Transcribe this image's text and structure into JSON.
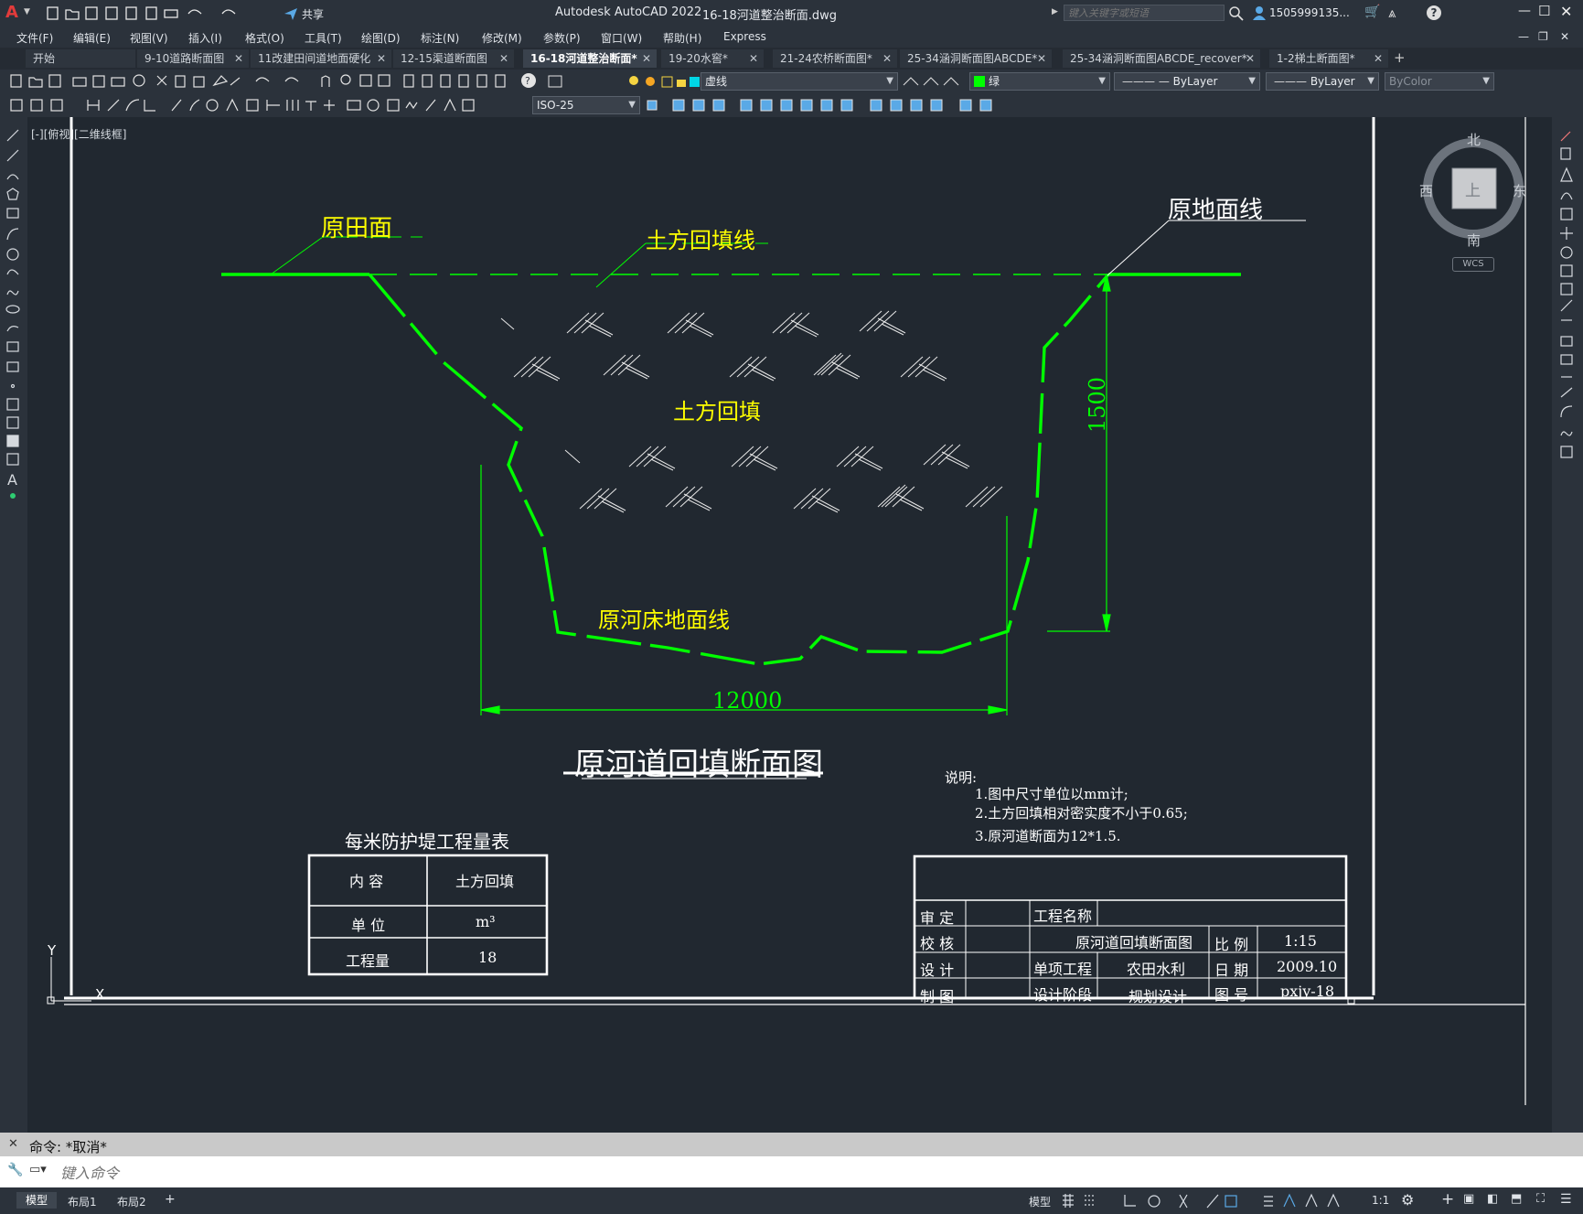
{
  "app": {
    "title": "Autodesk AutoCAD 2022",
    "filename": "16-18河道整治断面.dwg",
    "search_placeholder": "键入关键字或短语",
    "user": "1505999135...",
    "share": "共享"
  },
  "menu": [
    "文件(F)",
    "编辑(E)",
    "视图(V)",
    "插入(I)",
    "格式(O)",
    "工具(T)",
    "绘图(D)",
    "标注(N)",
    "修改(M)",
    "参数(P)",
    "窗口(W)",
    "帮助(H)",
    "Express"
  ],
  "tabs": [
    {
      "label": "开始",
      "active": false
    },
    {
      "label": "9-10道路断面图",
      "active": false
    },
    {
      "label": "11改建田间道地面硬化",
      "active": false
    },
    {
      "label": "12-15渠道断面图",
      "active": false
    },
    {
      "label": "16-18河道整治断面*",
      "active": true
    },
    {
      "label": "19-20水窖*",
      "active": false
    },
    {
      "label": "21-24农桥断面图*",
      "active": false
    },
    {
      "label": "25-34涵洞断面图ABCDE*",
      "active": false
    },
    {
      "label": "25-34涵洞断面图ABCDE_recover*",
      "active": false
    },
    {
      "label": "1-2梯土断面图*",
      "active": false
    }
  ],
  "toolbar": {
    "linetype_layer": "虚线",
    "color": "绿",
    "linetype": "ByLayer",
    "lineweight": "ByLayer",
    "plotstyle": "ByColor",
    "dimstyle": "ISO-25"
  },
  "viewport_label": "[-][俯视][二维线框]",
  "viewcube": {
    "north": "北",
    "south": "南",
    "east": "东",
    "west": "西",
    "top": "上",
    "wcs": "WCS"
  },
  "drawing": {
    "label_field": "原田面",
    "label_fill_line": "土方回填线",
    "label_ground_line": "原地面线",
    "label_fill": "土方回填",
    "label_riverbed": "原河床地面线",
    "dim_depth": "1500",
    "dim_width": "12000",
    "title": "原河道回填断面图",
    "notes_title": "说明:",
    "notes": [
      "1.图中尺寸单位以mm计;",
      "2.土方回填相对密实度不小于0.65;",
      "3.原河道断面为12*1.5."
    ],
    "table_title": "每米防护堤工程量表",
    "table": [
      [
        "内 容",
        "土方回填"
      ],
      [
        "单 位",
        "m³"
      ],
      [
        "工程量",
        "18"
      ]
    ],
    "titleblock": {
      "review": "审 定",
      "check": "校 核",
      "design": "设 计",
      "draw": "制 图",
      "project_name_label": "工程名称",
      "drawing_name": "原河道回填断面图",
      "item_label": "单项工程",
      "item_value": "农田水利",
      "stage_label": "设计阶段",
      "stage_value": "规划设计",
      "scale_label": "比 例",
      "scale_value": "1:15",
      "date_label": "日 期",
      "date_value": "2009.10",
      "number_label": "图 号",
      "number_value": "pxjy-18"
    },
    "ucs_y": "Y",
    "ucs_x": "X"
  },
  "command": {
    "history": "命令: *取消*",
    "placeholder": "键入命令"
  },
  "layout_tabs": [
    "模型",
    "布局1",
    "布局2"
  ],
  "status": {
    "model": "模型",
    "scale": "1:1"
  },
  "colors": {
    "drawing_green": "#00ff00",
    "label_yellow": "#ffff00",
    "background": "#212830",
    "white": "#ffffff"
  }
}
